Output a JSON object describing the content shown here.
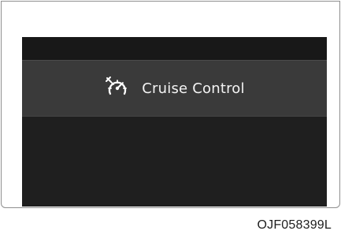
{
  "display": {
    "label": "Cruise Control",
    "icon": "cruise-control-icon"
  },
  "caption": {
    "code": "OJF058399L"
  }
}
